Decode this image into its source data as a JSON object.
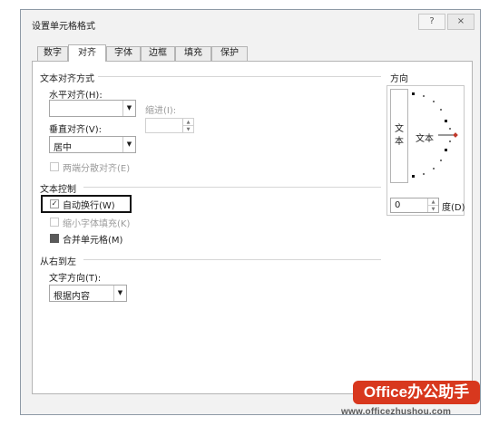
{
  "window": {
    "title": "设置单元格格式",
    "help_label": "?",
    "close_label": "×"
  },
  "tabs": [
    {
      "label": "数字",
      "active": false
    },
    {
      "label": "对齐",
      "active": true
    },
    {
      "label": "字体",
      "active": false
    },
    {
      "label": "边框",
      "active": false
    },
    {
      "label": "填充",
      "active": false
    },
    {
      "label": "保护",
      "active": false
    }
  ],
  "alignment": {
    "section_title": "文本对齐方式",
    "horizontal_label": "水平对齐(H):",
    "horizontal_value": "",
    "indent_label": "缩进(I):",
    "indent_value": "",
    "vertical_label": "垂直对齐(V):",
    "vertical_value": "居中",
    "distributed_label": "两端分散对齐(E)",
    "distributed_checked": false
  },
  "text_control": {
    "section_title": "文本控制",
    "wrap_label": "自动换行(W)",
    "wrap_checked": true,
    "shrink_label": "缩小字体填充(K)",
    "shrink_checked": false,
    "merge_label": "合并单元格(M)",
    "merge_state": "indeterminate"
  },
  "rtl": {
    "section_title": "从右到左",
    "direction_label": "文字方向(T):",
    "direction_value": "根据内容"
  },
  "orientation": {
    "section_title": "方向",
    "vertical_text": [
      "文",
      "本"
    ],
    "dial_text": "文本",
    "degrees_value": "0",
    "degrees_label": "度(D)"
  },
  "watermark": {
    "brand": "Office办公助手",
    "url": "www.officezhushou.com"
  },
  "colors": {
    "accent": "#d8381e",
    "dial_marker": "#c0392b"
  }
}
